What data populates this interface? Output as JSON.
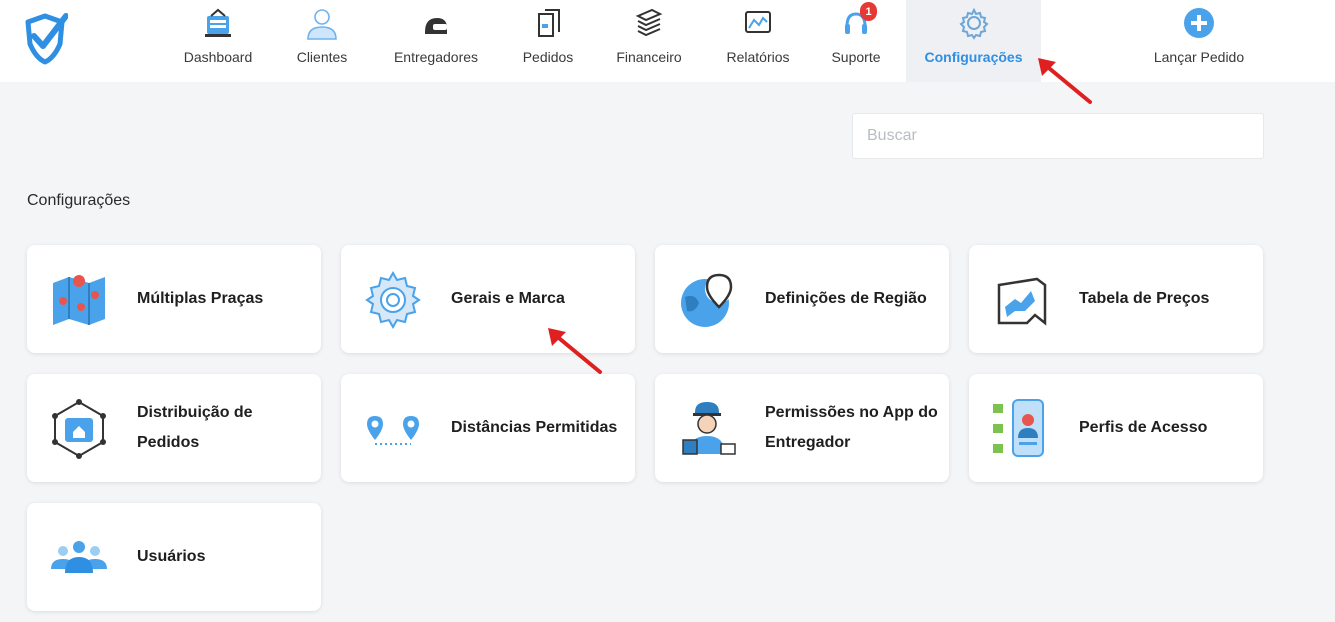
{
  "nav": {
    "items": [
      {
        "label": "Dashboard",
        "icon": "dashboard-icon"
      },
      {
        "label": "Clientes",
        "icon": "user-icon"
      },
      {
        "label": "Entregadores",
        "icon": "helmet-icon"
      },
      {
        "label": "Pedidos",
        "icon": "receipt-icon"
      },
      {
        "label": "Financeiro",
        "icon": "money-stack-icon"
      },
      {
        "label": "Relatórios",
        "icon": "chart-icon"
      },
      {
        "label": "Suporte",
        "icon": "headset-icon",
        "badge": "1"
      },
      {
        "label": "Configurações",
        "icon": "gear-icon",
        "active": true
      },
      {
        "label": "Lançar Pedido",
        "icon": "plus-circle-icon"
      }
    ]
  },
  "search": {
    "placeholder": "Buscar",
    "value": ""
  },
  "section": {
    "title": "Configurações"
  },
  "cards": [
    {
      "label": "Múltiplas Praças",
      "icon": "map-pins-icon"
    },
    {
      "label": "Gerais e Marca",
      "icon": "gear-icon"
    },
    {
      "label": "Definições de Região",
      "icon": "globe-pin-icon"
    },
    {
      "label": "Tabela de Preços",
      "icon": "price-table-icon"
    },
    {
      "label": "Distribuição de Pedidos",
      "icon": "network-distribution-icon"
    },
    {
      "label": "Distâncias Permitidas",
      "icon": "route-pins-icon"
    },
    {
      "label": "Permissões no App do Entregador",
      "icon": "courier-icon"
    },
    {
      "label": "Perfis de Acesso",
      "icon": "profile-checklist-icon"
    },
    {
      "label": "Usuários",
      "icon": "users-group-icon"
    }
  ],
  "colors": {
    "accent": "#2f8fe3",
    "icon_blue": "#4aa3ea",
    "icon_dark": "#333333",
    "badge": "#e53935",
    "arrow": "#e02020",
    "background": "#f4f5f7"
  }
}
